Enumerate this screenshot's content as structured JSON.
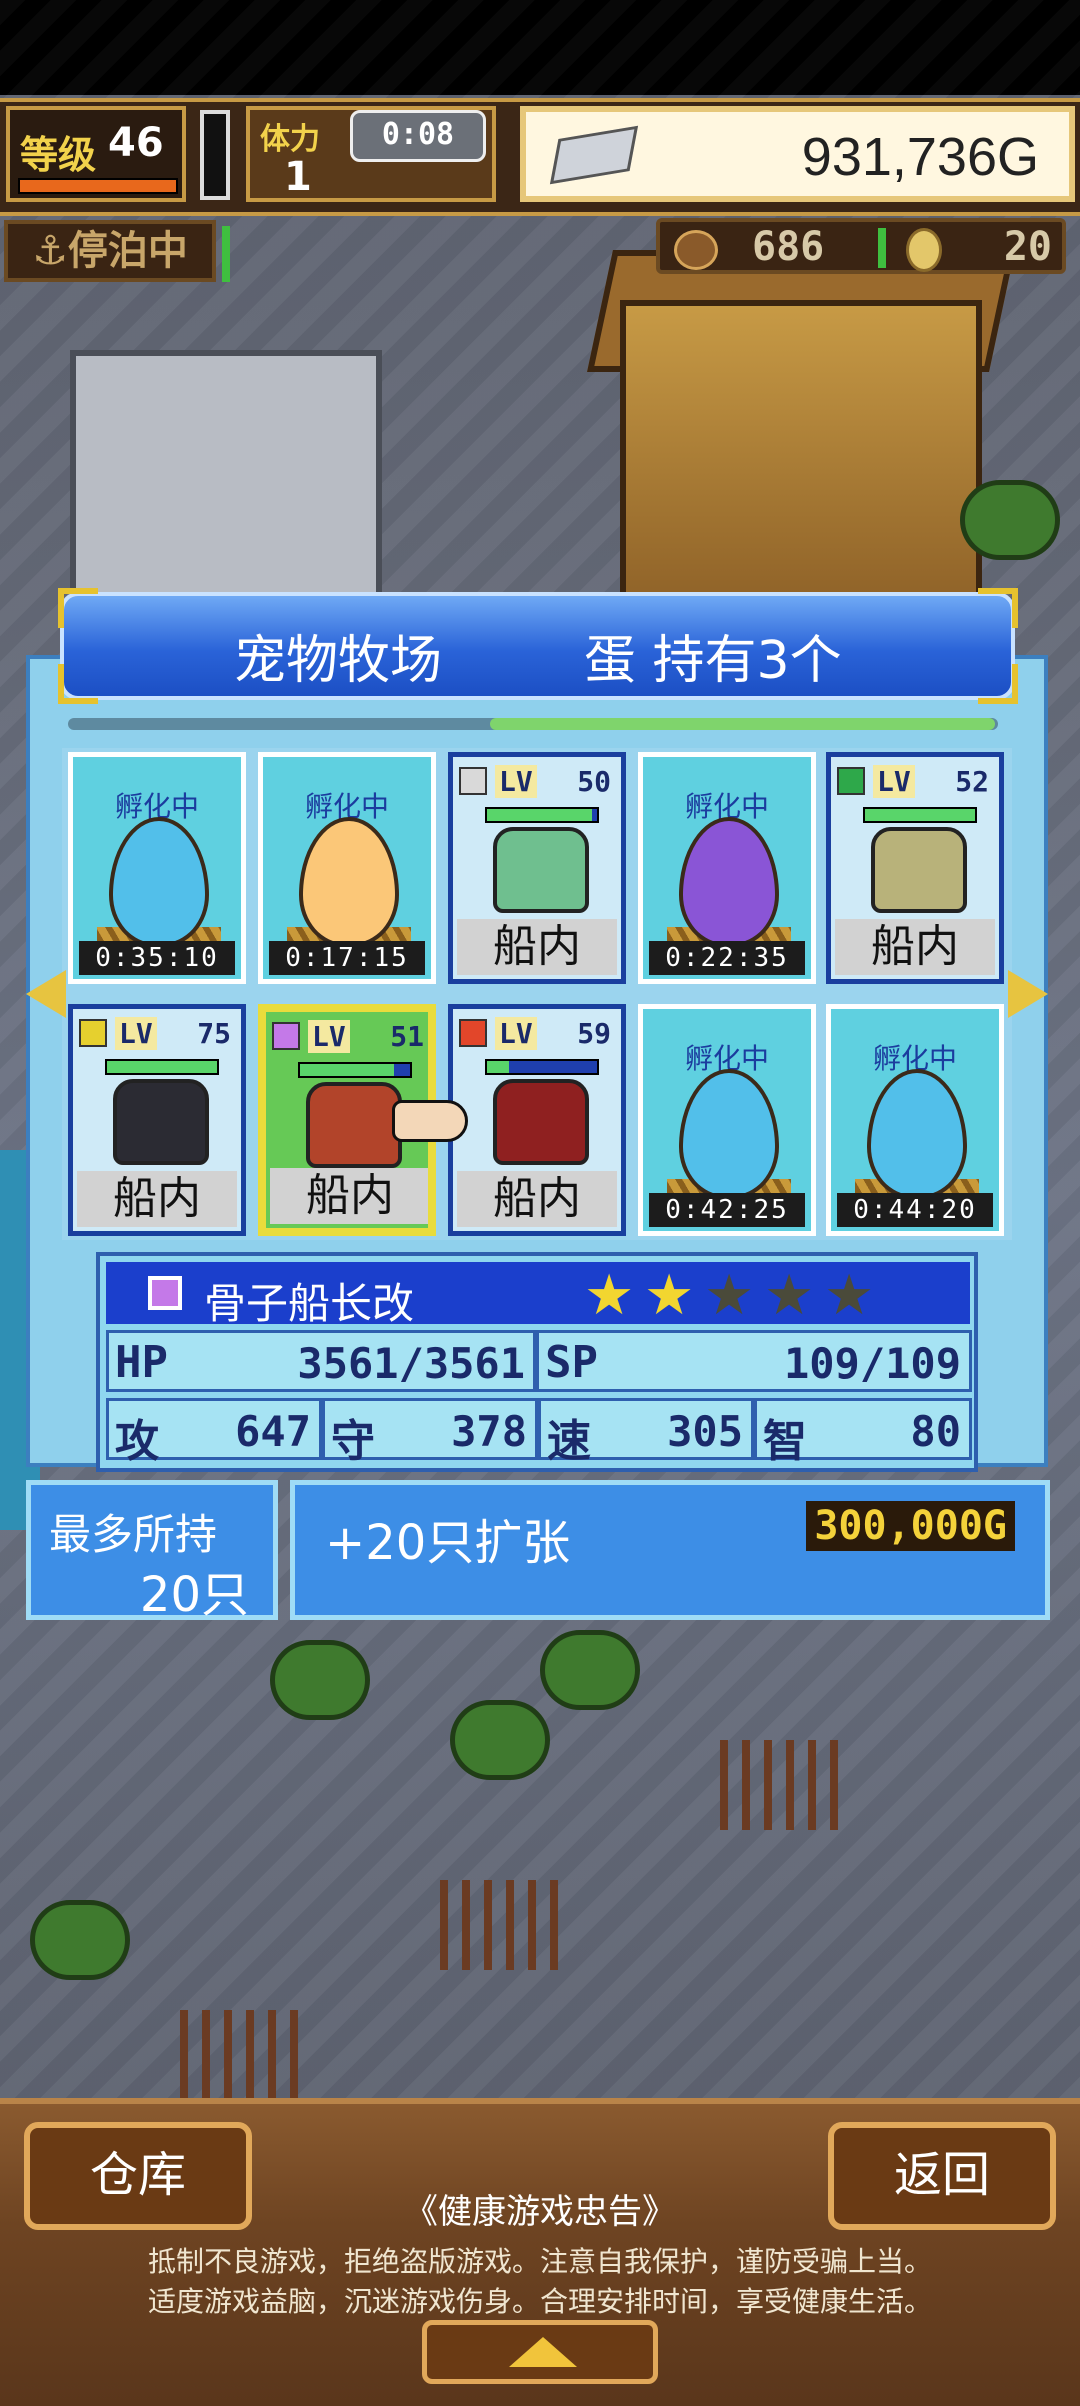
{
  "hud": {
    "level_label": "等级",
    "level_value": "46",
    "stamina_label": "体力",
    "stamina_value": "1",
    "stamina_timer": "0:08",
    "gold": "931,736G",
    "dock_status": "停泊中",
    "resource1": "686",
    "resource2": "20"
  },
  "ranch": {
    "title": "宠物牧场",
    "egg_count": "蛋 持有3个",
    "cells": [
      {
        "type": "egg",
        "label": "孵化中",
        "timer": "0:35:10",
        "color": "#52bfea"
      },
      {
        "type": "egg",
        "label": "孵化中",
        "timer": "0:17:15",
        "color": "#fbc778"
      },
      {
        "type": "mon",
        "lv_label": "LV",
        "lv": "50",
        "status": "船内",
        "icon_color": "#d9d9d9",
        "sprite_color": "#6fbf8f",
        "hp": 0.95
      },
      {
        "type": "egg",
        "label": "孵化中",
        "timer": "0:22:35",
        "color": "#8a55d6"
      },
      {
        "type": "mon",
        "lv_label": "LV",
        "lv": "52",
        "status": "船内",
        "icon_color": "#2ea84a",
        "sprite_color": "#b8b27a",
        "hp": 1.0
      },
      {
        "type": "mon",
        "lv_label": "LV",
        "lv": "75",
        "status": "船内",
        "icon_color": "#e6d02e",
        "sprite_color": "#2b2b33",
        "hp": 1.0
      },
      {
        "type": "mon",
        "lv_label": "LV",
        "lv": "51",
        "status": "船内",
        "icon_color": "#c479e8",
        "sprite_color": "#b2442a",
        "hp": 0.85,
        "selected": true
      },
      {
        "type": "mon",
        "lv_label": "LV",
        "lv": "59",
        "status": "船内",
        "icon_color": "#e2462a",
        "sprite_color": "#8f2020",
        "hp": 0.2
      },
      {
        "type": "egg",
        "label": "孵化中",
        "timer": "0:42:25",
        "color": "#52bfea"
      },
      {
        "type": "egg",
        "label": "孵化中",
        "timer": "0:44:20",
        "color": "#52bfea"
      }
    ]
  },
  "selected": {
    "name": "骨子船长改",
    "stars_filled": 2,
    "stars_total": 5,
    "hp_label": "HP",
    "hp": "3561/3561",
    "sp_label": "SP",
    "sp": "109/109",
    "atk_label": "攻",
    "atk": "647",
    "def_label": "守",
    "def": "378",
    "spd_label": "速",
    "spd": "305",
    "int_label": "智",
    "int": "80"
  },
  "capacity": {
    "label": "最多所持",
    "value": "20只",
    "expand_label": "+20只扩张",
    "expand_price": "300,000G"
  },
  "bottom": {
    "left_button": "仓库",
    "right_button": "返回",
    "notice_title": "《健康游戏忠告》",
    "notice_line1": "抵制不良游戏，拒绝盗版游戏。注意自我保护，谨防受骗上当。",
    "notice_line2": "适度游戏益脑，沉迷游戏伤身。合理安排时间，享受健康生活。"
  },
  "colors": {
    "star_on": "#f2d630",
    "star_off": "#4a4a3a",
    "accent_blue": "#1b3fcc"
  }
}
